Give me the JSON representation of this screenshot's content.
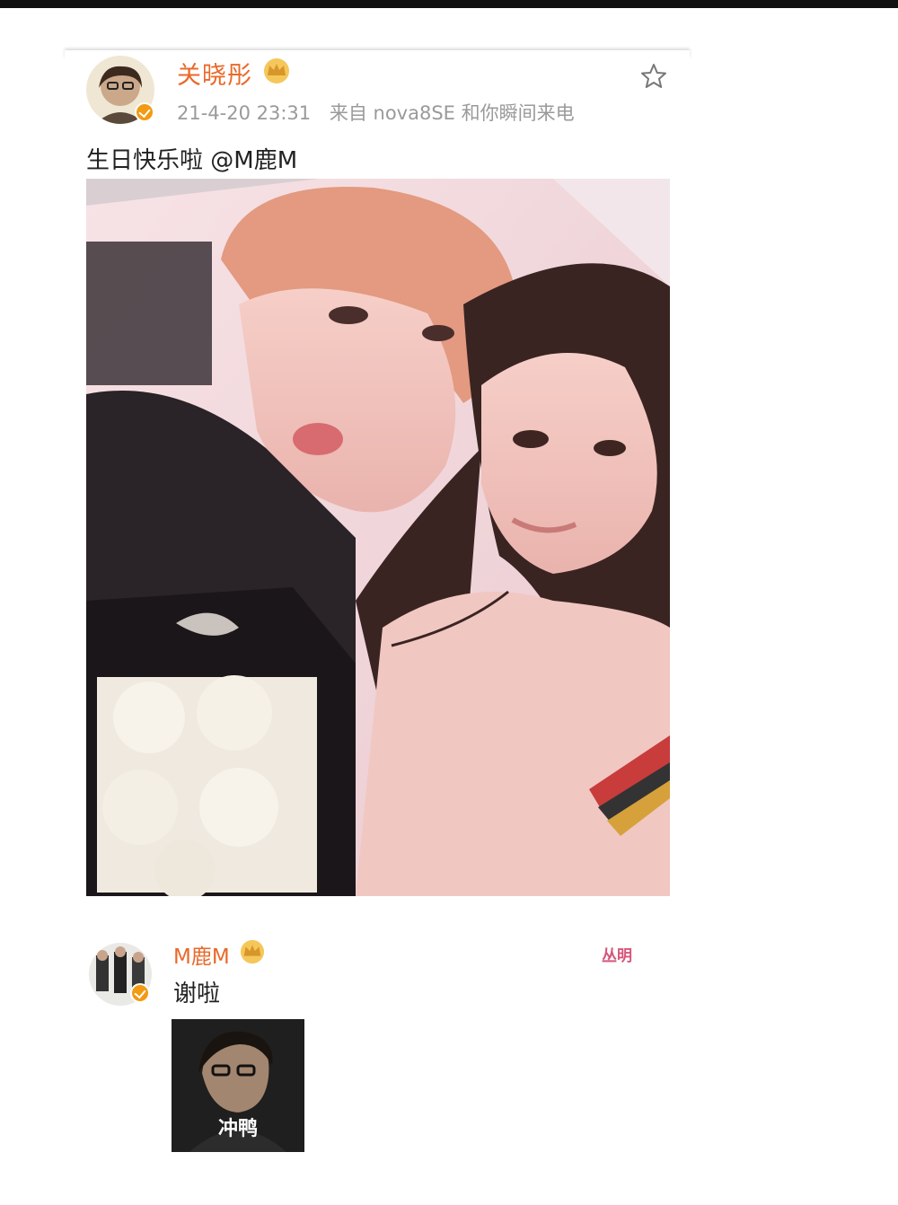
{
  "post": {
    "username": "关晓彤",
    "timestamp": "21-4-20 23:31",
    "source": "来自 nova8SE 和你瞬间来电",
    "text": "生日快乐啦 @M鹿M"
  },
  "reply": {
    "username": "M鹿M",
    "text": "谢啦",
    "tag": "丛明",
    "sticker_caption": "冲鸭"
  },
  "colors": {
    "username": "#e8692a",
    "verified_badge": "#f29a13",
    "meta": "#9a9a9a"
  },
  "icons": {
    "favorite": "star-icon",
    "member": "crown-icon",
    "verified": "verified-badge-icon"
  }
}
